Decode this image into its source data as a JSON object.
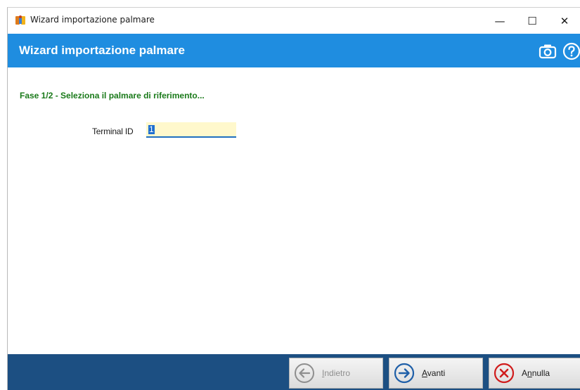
{
  "window": {
    "title": "Wizard importazione palmare",
    "minimize_glyph": "—",
    "maximize_glyph": "☐",
    "close_glyph": "✕"
  },
  "header": {
    "title": "Wizard importazione palmare",
    "icons": [
      "camera-icon",
      "help-icon"
    ],
    "color": "#1f8de0"
  },
  "step": {
    "title": "Fase 1/2 - Seleziona il palmare di riferimento..."
  },
  "form": {
    "terminal_id_label": "Terminal ID",
    "terminal_id_value": "1"
  },
  "footer": {
    "back_label_first": "I",
    "back_label_rest": "ndietro",
    "back_enabled": false,
    "next_label_first": "A",
    "next_label_rest": "vanti",
    "cancel_label_first": "A",
    "cancel_label_mid": "n",
    "cancel_label_rest": "nulla",
    "color": "#1c4f82"
  }
}
